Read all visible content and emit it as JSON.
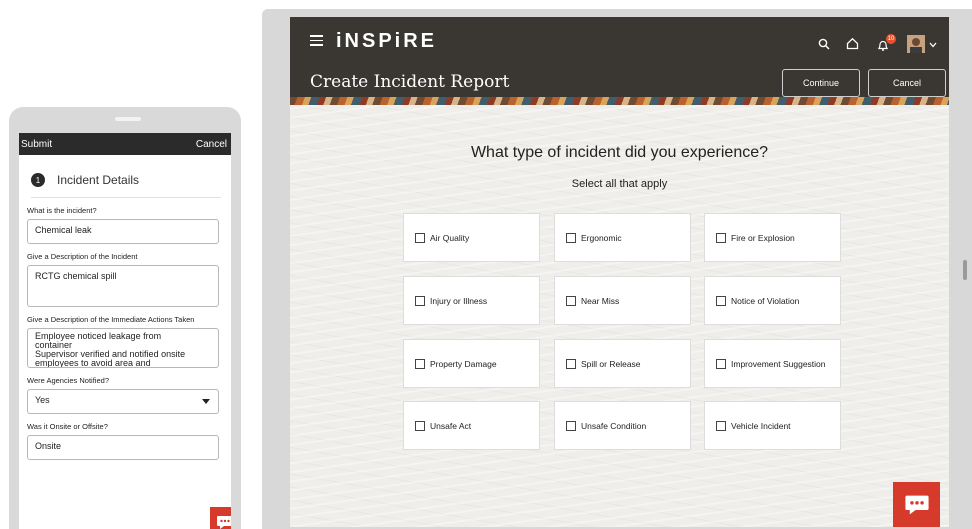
{
  "phone": {
    "submit": "Submit",
    "cancel": "Cancel",
    "section_number": "1",
    "section_title": "Incident Details",
    "q1_label": "What is the incident?",
    "q1_value": "Chemical leak",
    "q2_label": "Give a Description of the Incident",
    "q2_value": "RCTG chemical spill",
    "q3_label": "Give a Description of the Immediate Actions Taken",
    "q3_lines": [
      "Employee noticed leakage from",
      "container",
      "Supervisor verified and notified onsite",
      "employees to avoid area and"
    ],
    "q4_label": "Were Agencies Notified?",
    "q4_value": "Yes",
    "q5_label": "Was it Onsite or Offsite?",
    "q5_value": "Onsite"
  },
  "tablet": {
    "logo": "iNSPiRE",
    "page_title": "Create Incident Report",
    "notification_count": "10",
    "continue": "Continue",
    "cancel": "Cancel",
    "question": "What type of incident did you experience?",
    "subtitle": "Select all that apply",
    "options": [
      "Air Quality",
      "Ergonomic",
      "Fire or Explosion",
      "Injury or Illness",
      "Near Miss",
      "Notice of Violation",
      "Property Damage",
      "Spill or Release",
      "Improvement Suggestion",
      "Unsafe Act",
      "Unsafe Condition",
      "Vehicle Incident"
    ],
    "colors": {
      "header": "#3a3733",
      "accent": "#d63a2b",
      "badge": "#e4532e"
    }
  }
}
